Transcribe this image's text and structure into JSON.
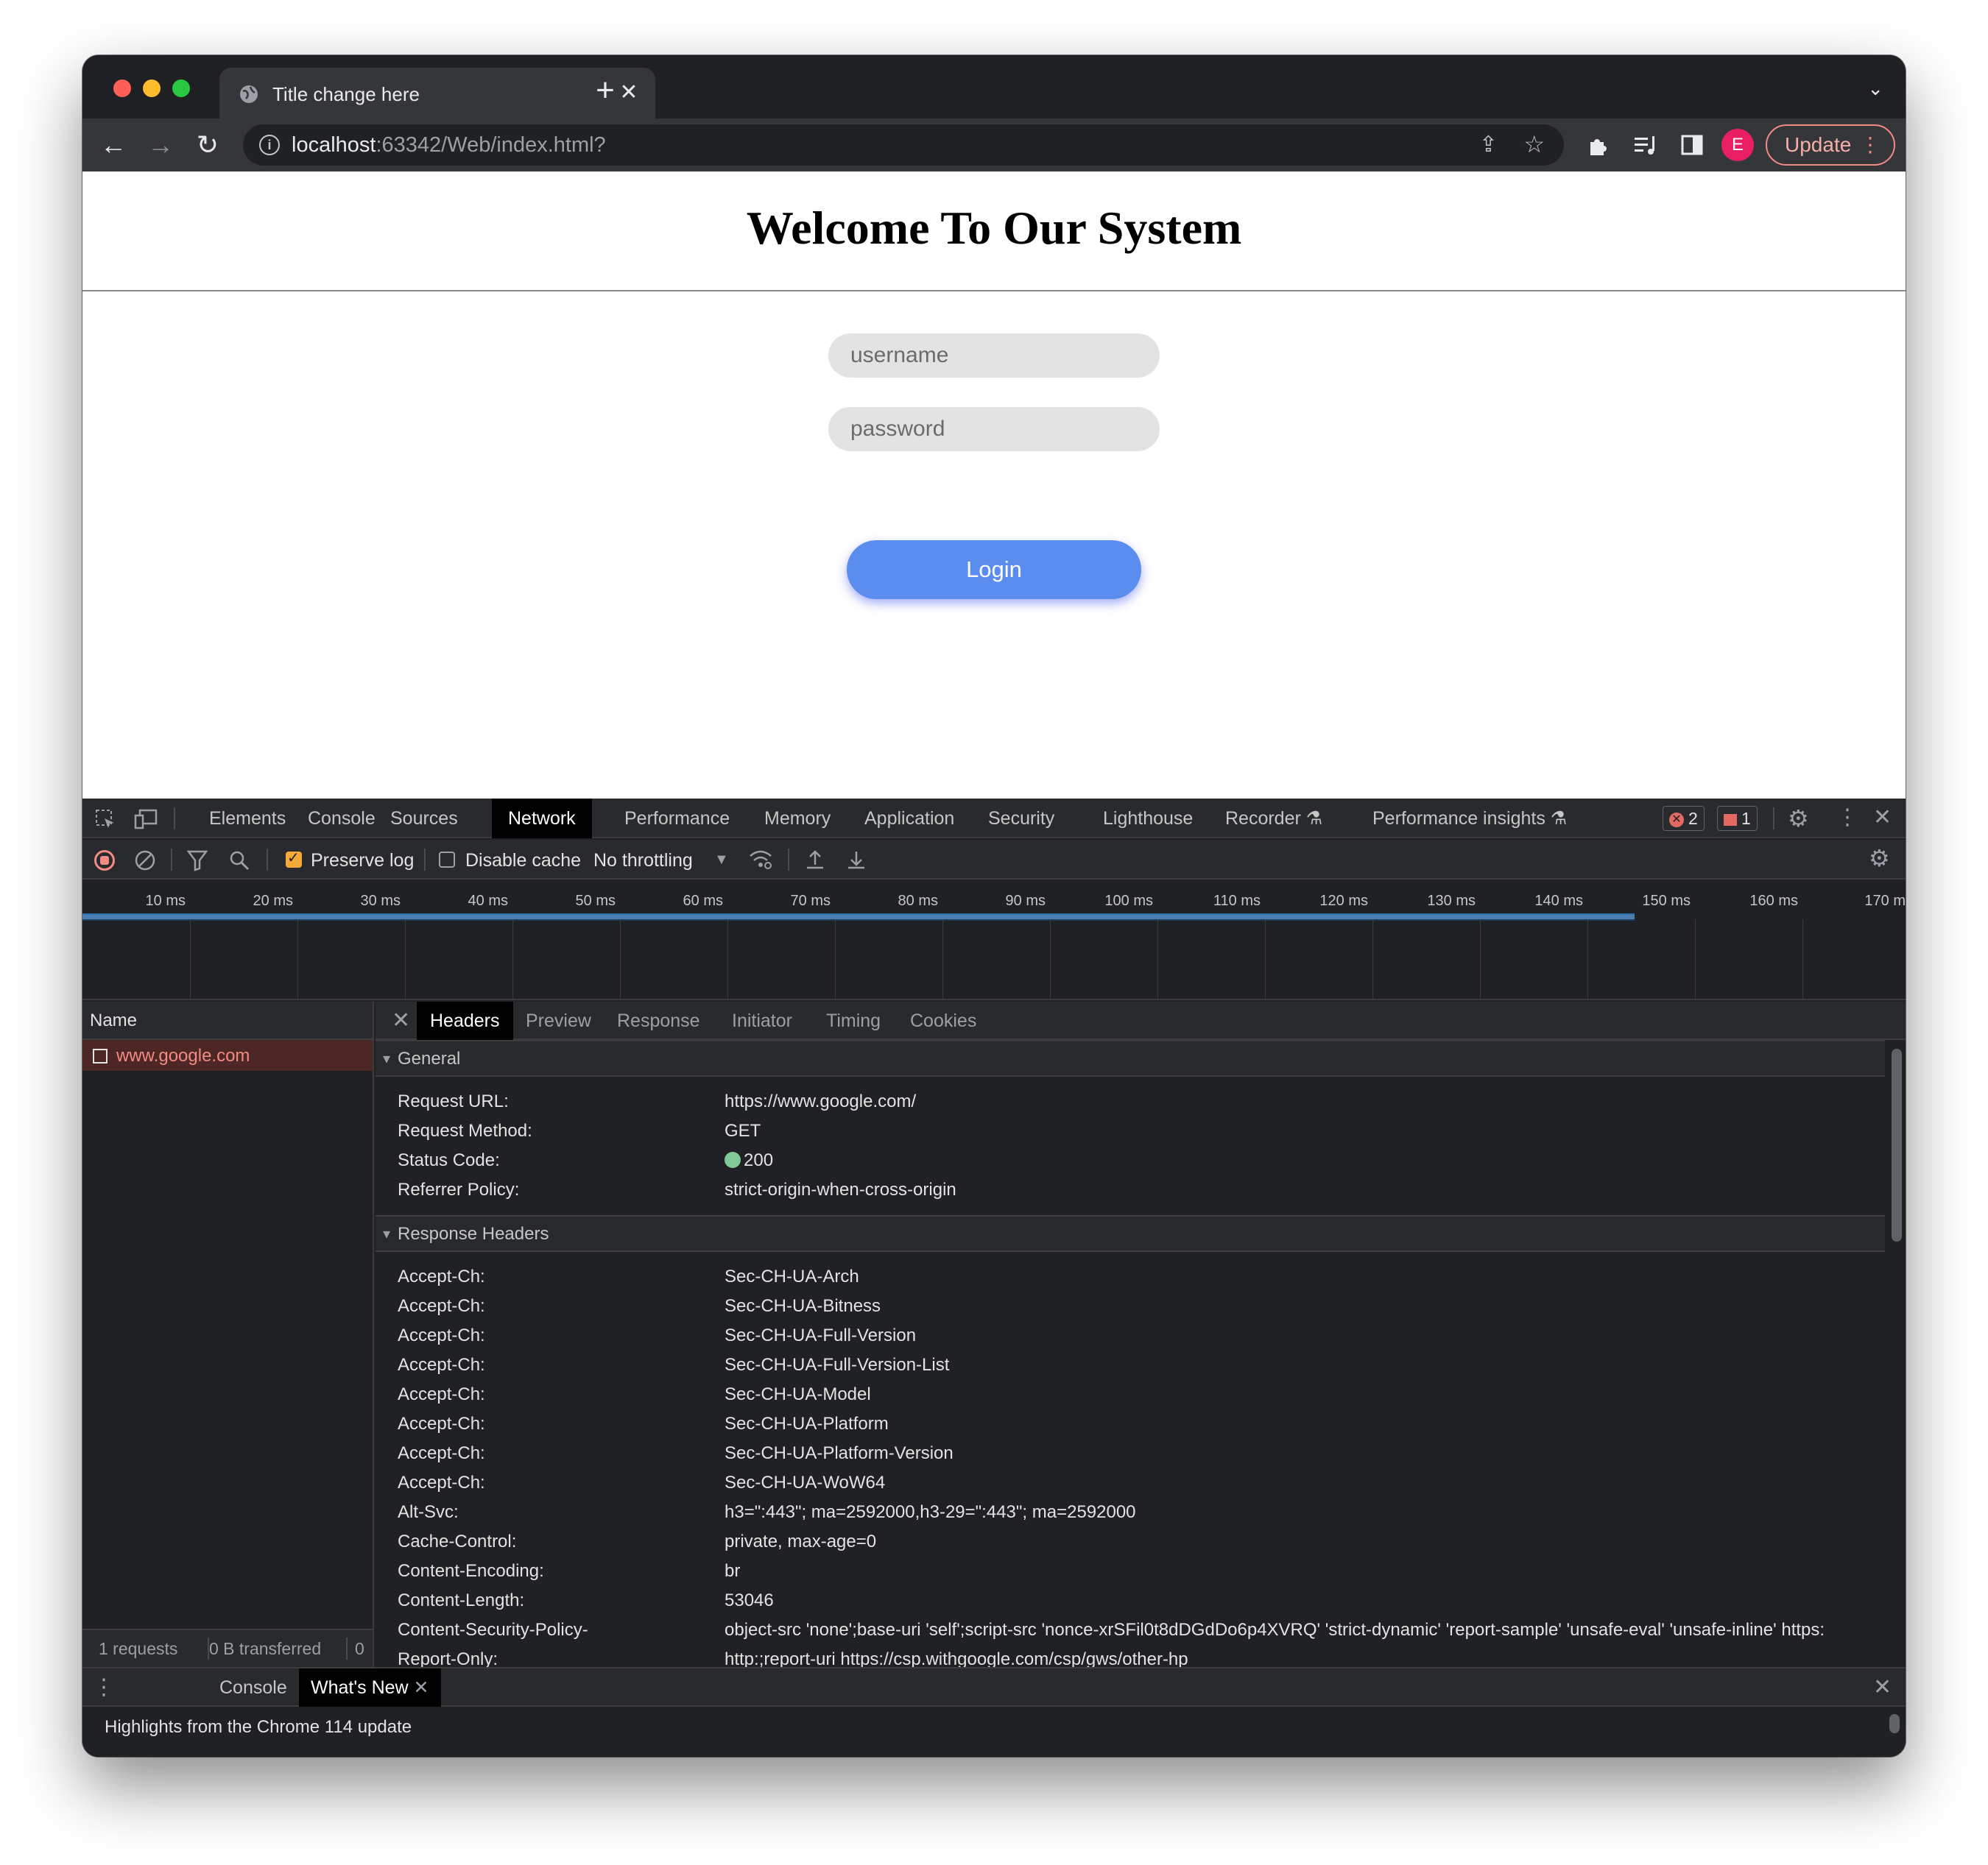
{
  "browser": {
    "tab_title": "Title change here",
    "url_host": "localhost",
    "url_rest": ":63342/Web/index.html?",
    "update_label": "Update",
    "avatar_letter": "E"
  },
  "page": {
    "title": "Welcome To Our System",
    "username_placeholder": "username",
    "password_placeholder": "password",
    "login_label": "Login"
  },
  "devtools": {
    "tabs": [
      "Elements",
      "Console",
      "Sources",
      "Network",
      "Performance",
      "Memory",
      "Application",
      "Security",
      "Lighthouse",
      "Recorder",
      "Performance insights"
    ],
    "active_tab": "Network",
    "error_count": "2",
    "issue_count": "1",
    "network": {
      "preserve_log": "Preserve log",
      "disable_cache": "Disable cache",
      "throttling": "No throttling"
    },
    "timeline_ticks": [
      "10 ms",
      "20 ms",
      "30 ms",
      "40 ms",
      "50 ms",
      "60 ms",
      "70 ms",
      "80 ms",
      "90 ms",
      "100 ms",
      "110 ms",
      "120 ms",
      "130 ms",
      "140 ms",
      "150 ms",
      "160 ms",
      "170 m"
    ],
    "requests": {
      "header": "Name",
      "items": [
        "www.google.com"
      ],
      "footer_requests": "1 requests",
      "footer_transferred": "0 B transferred",
      "footer_extra": "0"
    },
    "detail_tabs": [
      "Headers",
      "Preview",
      "Response",
      "Initiator",
      "Timing",
      "Cookies"
    ],
    "general": {
      "title": "General",
      "rows": [
        {
          "k": "Request URL:",
          "v": "https://www.google.com/"
        },
        {
          "k": "Request Method:",
          "v": "GET"
        },
        {
          "k": "Status Code:",
          "v": "200"
        },
        {
          "k": "Referrer Policy:",
          "v": "strict-origin-when-cross-origin"
        }
      ]
    },
    "response_headers": {
      "title": "Response Headers",
      "rows": [
        {
          "k": "Accept-Ch:",
          "v": "Sec-CH-UA-Arch"
        },
        {
          "k": "Accept-Ch:",
          "v": "Sec-CH-UA-Bitness"
        },
        {
          "k": "Accept-Ch:",
          "v": "Sec-CH-UA-Full-Version"
        },
        {
          "k": "Accept-Ch:",
          "v": "Sec-CH-UA-Full-Version-List"
        },
        {
          "k": "Accept-Ch:",
          "v": "Sec-CH-UA-Model"
        },
        {
          "k": "Accept-Ch:",
          "v": "Sec-CH-UA-Platform"
        },
        {
          "k": "Accept-Ch:",
          "v": "Sec-CH-UA-Platform-Version"
        },
        {
          "k": "Accept-Ch:",
          "v": "Sec-CH-UA-WoW64"
        },
        {
          "k": "Alt-Svc:",
          "v": "h3=\":443\"; ma=2592000,h3-29=\":443\"; ma=2592000"
        },
        {
          "k": "Cache-Control:",
          "v": "private, max-age=0"
        },
        {
          "k": "Content-Encoding:",
          "v": "br"
        },
        {
          "k": "Content-Length:",
          "v": "53046"
        },
        {
          "k": "Content-Security-Policy-",
          "v": "object-src 'none';base-uri 'self';script-src 'nonce-xrSFil0t8dDGdDo6p4XVRQ' 'strict-dynamic' 'report-sample' 'unsafe-eval' 'unsafe-inline' https:"
        },
        {
          "k": "Report-Only:",
          "v": "http:;report-uri https://csp.withgoogle.com/csp/gws/other-hp"
        }
      ]
    },
    "drawer": {
      "tabs": [
        "Console",
        "What's New"
      ],
      "active_tab": "What's New",
      "text": "Highlights from the Chrome 114 update"
    }
  }
}
